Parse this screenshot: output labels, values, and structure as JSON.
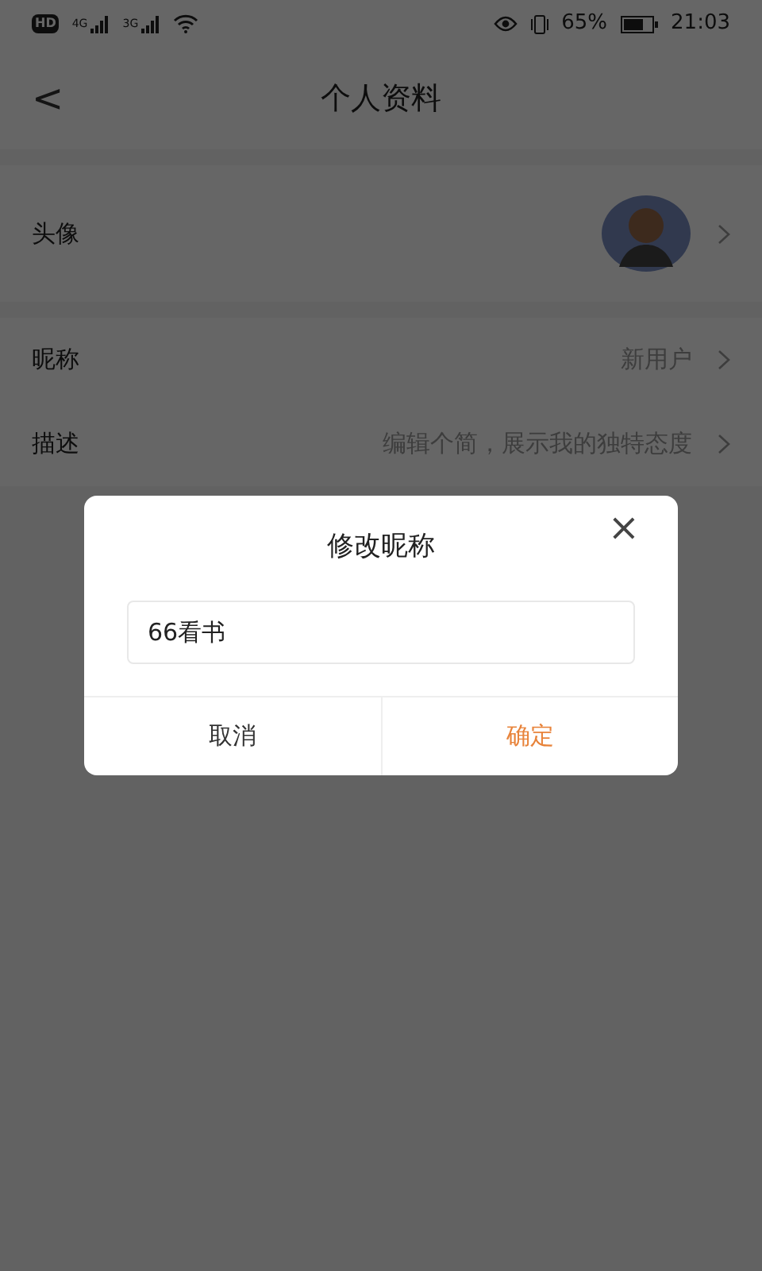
{
  "status_bar": {
    "network_labels": [
      "HD",
      "4G",
      "3G"
    ],
    "battery_percent": "65%",
    "time": "21:03"
  },
  "header": {
    "back": "<",
    "title": "个人资料"
  },
  "profile_rows": [
    {
      "kind": "avatar",
      "label": "头像"
    },
    {
      "kind": "text",
      "label": "昵称",
      "value": "新用户"
    },
    {
      "kind": "text",
      "label": "描述",
      "value": "编辑个简，展示我的独特态度"
    }
  ],
  "dialog": {
    "title": "修改昵称",
    "close": "×",
    "input": {
      "value": "66看书"
    },
    "buttons": [
      {
        "label": "取消",
        "primary": false
      },
      {
        "label": "确定",
        "primary": true
      }
    ]
  }
}
